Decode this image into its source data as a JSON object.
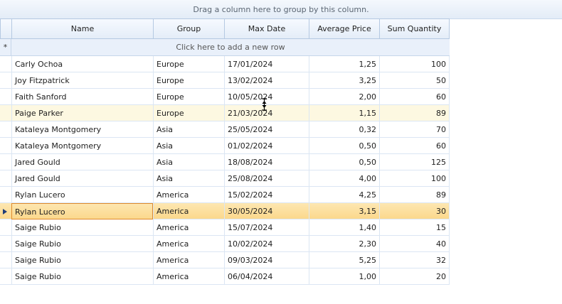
{
  "group_panel": {
    "hint": "Drag a column here to group by this column."
  },
  "columns": [
    "Name",
    "Group",
    "Max Date",
    "Average Price",
    "Sum Quantity"
  ],
  "new_row": {
    "marker": "*",
    "text": "Click here to add a new row"
  },
  "rows": [
    {
      "name": "Carly Ochoa",
      "group": "Europe",
      "date": "17/01/2024",
      "price": "1,25",
      "qty": "100"
    },
    {
      "name": "Joy Fitzpatrick",
      "group": "Europe",
      "date": "13/02/2024",
      "price": "3,25",
      "qty": "50"
    },
    {
      "name": "Faith Sanford",
      "group": "Europe",
      "date": "10/05/2024",
      "price": "2,00",
      "qty": "60"
    },
    {
      "name": "Paige Parker",
      "group": "Europe",
      "date": "21/03/2024",
      "price": "1,15",
      "qty": "89"
    },
    {
      "name": "Kataleya Montgomery",
      "group": "Asia",
      "date": "25/05/2024",
      "price": "0,32",
      "qty": "70"
    },
    {
      "name": "Kataleya Montgomery",
      "group": "Asia",
      "date": "01/02/2024",
      "price": "0,50",
      "qty": "60"
    },
    {
      "name": "Jared Gould",
      "group": "Asia",
      "date": "18/08/2024",
      "price": "0,50",
      "qty": "125"
    },
    {
      "name": "Jared Gould",
      "group": "Asia",
      "date": "25/08/2024",
      "price": "4,00",
      "qty": "100"
    },
    {
      "name": "Rylan Lucero",
      "group": "America",
      "date": "15/02/2024",
      "price": "4,25",
      "qty": "89"
    },
    {
      "name": "Rylan Lucero",
      "group": "America",
      "date": "30/05/2024",
      "price": "3,15",
      "qty": "30"
    },
    {
      "name": "Saige Rubio",
      "group": "America",
      "date": "15/07/2024",
      "price": "1,40",
      "qty": "15"
    },
    {
      "name": "Saige Rubio",
      "group": "America",
      "date": "10/02/2024",
      "price": "2,30",
      "qty": "40"
    },
    {
      "name": "Saige Rubio",
      "group": "America",
      "date": "09/03/2024",
      "price": "5,25",
      "qty": "32"
    },
    {
      "name": "Saige Rubio",
      "group": "America",
      "date": "06/04/2024",
      "price": "1,00",
      "qty": "20"
    }
  ],
  "current_row_index": 9,
  "hover_row_index": 3,
  "colors": {
    "header_bg": "#e4edf8",
    "current_row": "#fbd88c",
    "hover_row": "#fdf8e1",
    "focus_border": "#e08a2c"
  }
}
